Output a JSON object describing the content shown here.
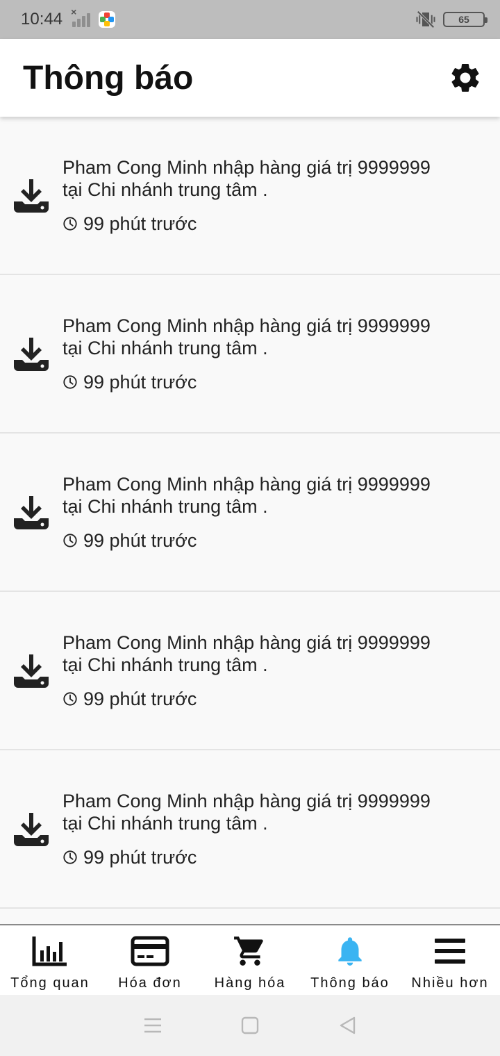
{
  "status_bar": {
    "time": "10:44",
    "battery": "65"
  },
  "header": {
    "title": "Thông báo"
  },
  "notifications": [
    {
      "text": "Pham Cong Minh nhập hàng giá trị 9999999 tại Chi nhánh trung tâm .",
      "time": "99 phút trước"
    },
    {
      "text": "Pham Cong Minh nhập hàng giá trị 9999999 tại Chi nhánh trung tâm .",
      "time": "99 phút trước"
    },
    {
      "text": "Pham Cong Minh nhập hàng giá trị 9999999 tại Chi nhánh trung tâm .",
      "time": "99 phút trước"
    },
    {
      "text": "Pham Cong Minh nhập hàng giá trị 9999999 tại Chi nhánh trung tâm .",
      "time": "99 phút trước"
    },
    {
      "text": "Pham Cong Minh nhập hàng giá trị 9999999 tại Chi nhánh trung tâm .",
      "time": "99 phút trước"
    }
  ],
  "bottom_nav": [
    {
      "label": "Tổng quan",
      "icon": "bar-chart-icon",
      "active": false
    },
    {
      "label": "Hóa đơn",
      "icon": "credit-card-icon",
      "active": false
    },
    {
      "label": "Hàng hóa",
      "icon": "cart-icon",
      "active": false
    },
    {
      "label": "Thông báo",
      "icon": "bell-icon",
      "active": true
    },
    {
      "label": "Nhiều hơn",
      "icon": "menu-icon",
      "active": false
    }
  ],
  "colors": {
    "active": "#3ab4f2",
    "inactive": "#111111",
    "background": "#f9f9f9"
  }
}
